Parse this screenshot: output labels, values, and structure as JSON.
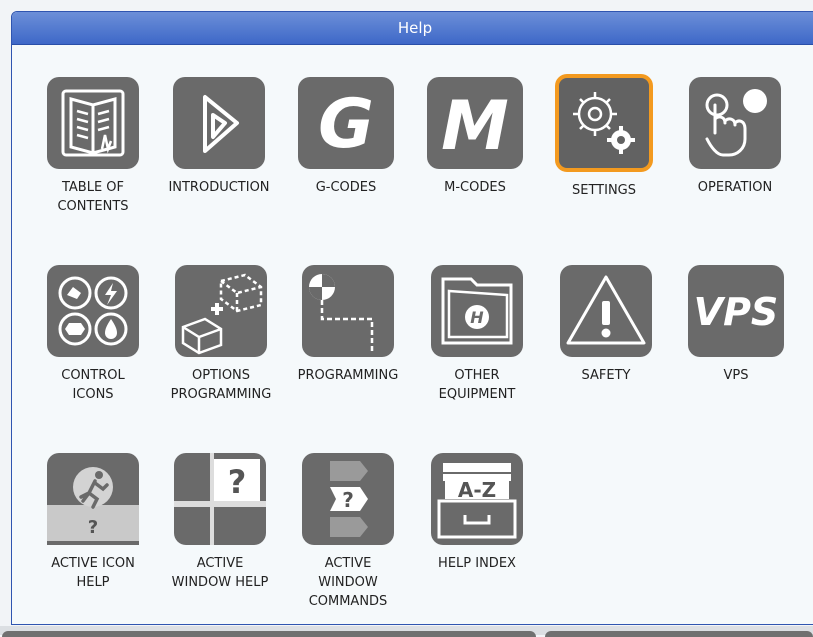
{
  "window": {
    "title": "Help"
  },
  "colors": {
    "title_bar": "#4a72cf",
    "tile_bg": "#6a6a6a",
    "selected_border": "#f39a1f",
    "window_bg": "#f5f9fb"
  },
  "tiles": [
    {
      "id": "table-of-contents",
      "label": "TABLE OF\nCONTENTS",
      "icon": "book-icon",
      "selected": false
    },
    {
      "id": "introduction",
      "label": "INTRODUCTION",
      "icon": "play-triangle-icon",
      "selected": false
    },
    {
      "id": "g-codes",
      "label": "G-CODES",
      "icon": "letter-g-icon",
      "selected": false
    },
    {
      "id": "m-codes",
      "label": "M-CODES",
      "icon": "letter-m-icon",
      "selected": false
    },
    {
      "id": "settings",
      "label": "SETTINGS",
      "icon": "gears-icon",
      "selected": true
    },
    {
      "id": "operation",
      "label": "OPERATION",
      "icon": "hand-pointer-icon",
      "selected": false
    },
    {
      "id": "control-icons",
      "label": "CONTROL\nICONS",
      "icon": "control-icons-grid-icon",
      "selected": false
    },
    {
      "id": "options-programming",
      "label": "OPTIONS\nPROGRAMMING",
      "icon": "boxes-icon",
      "selected": false
    },
    {
      "id": "programming",
      "label": "PROGRAMMING",
      "icon": "path-icon",
      "selected": false
    },
    {
      "id": "other-equipment",
      "label": "OTHER\nEQUIPMENT",
      "icon": "folder-logo-icon",
      "selected": false
    },
    {
      "id": "safety",
      "label": "SAFETY",
      "icon": "warning-icon",
      "selected": false
    },
    {
      "id": "vps",
      "label": "VPS",
      "icon": "vps-text-icon",
      "selected": false
    },
    {
      "id": "active-icon-help",
      "label": "ACTIVE ICON\nHELP",
      "icon": "running-man-icon",
      "selected": false
    },
    {
      "id": "active-window-help",
      "label": "ACTIVE\nWINDOW HELP",
      "icon": "window-question-icon",
      "selected": false
    },
    {
      "id": "active-window-commands",
      "label": "ACTIVE\nWINDOW\nCOMMANDS",
      "icon": "command-stack-icon",
      "selected": false
    },
    {
      "id": "help-index",
      "label": "HELP INDEX",
      "icon": "a-z-drawer-icon",
      "selected": false
    }
  ],
  "icon_text": {
    "g": "G",
    "m": "M",
    "vps": "VPS",
    "az": "A-Z",
    "q": "?"
  }
}
